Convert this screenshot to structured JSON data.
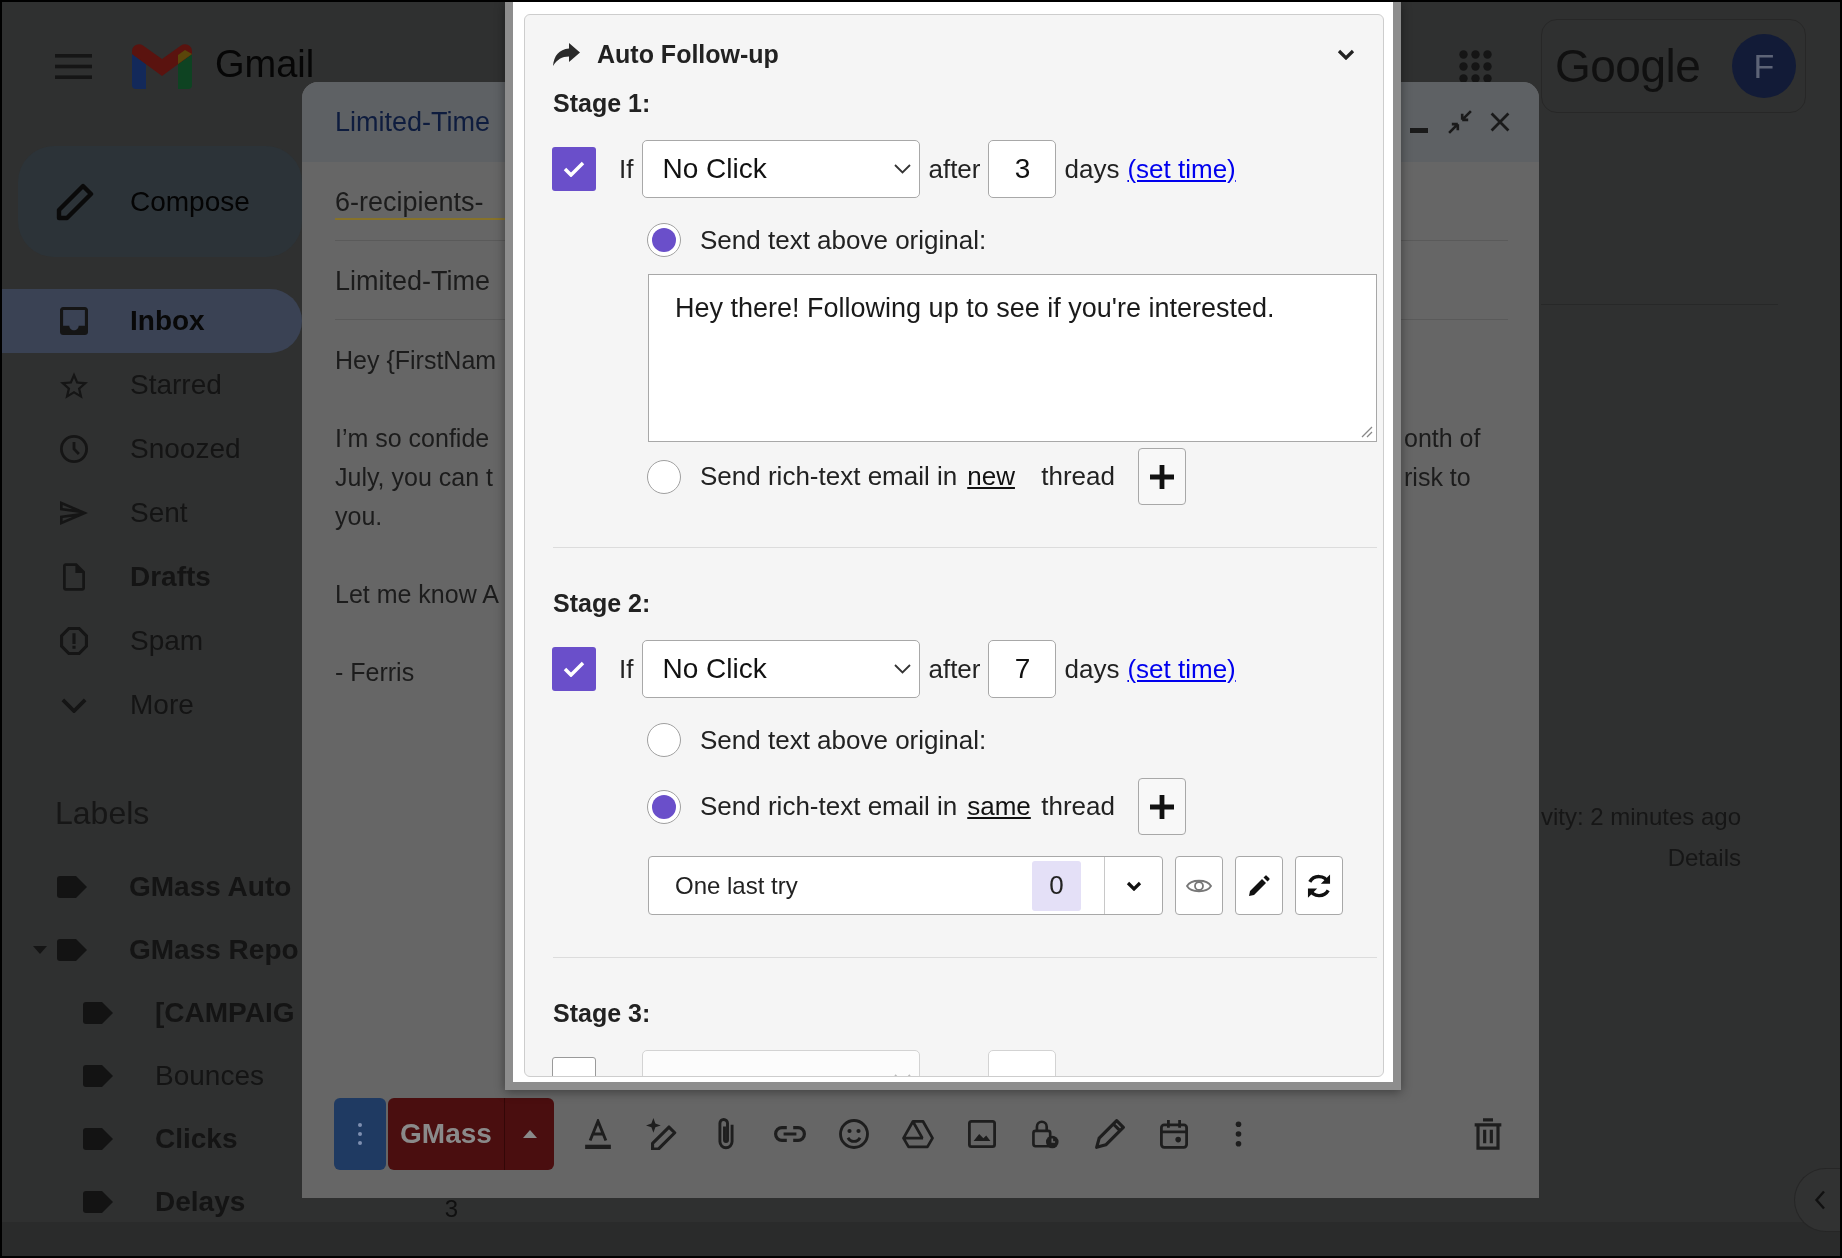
{
  "topbar": {
    "app_name": "Gmail",
    "brand": "Google",
    "account_initial": "F"
  },
  "sidebar": {
    "compose_label": "Compose",
    "nav_items": [
      {
        "kind": "inbox",
        "label": "Inbox",
        "selected": true,
        "unread": true
      },
      {
        "kind": "starred",
        "label": "Starred",
        "selected": false,
        "unread": false
      },
      {
        "kind": "snoozed",
        "label": "Snoozed",
        "selected": false,
        "unread": false
      },
      {
        "kind": "sent",
        "label": "Sent",
        "selected": false,
        "unread": false
      },
      {
        "kind": "drafts",
        "label": "Drafts",
        "selected": false,
        "unread": true
      },
      {
        "kind": "spam",
        "label": "Spam",
        "selected": false,
        "unread": false
      },
      {
        "kind": "more",
        "label": "More",
        "selected": false,
        "unread": false
      }
    ],
    "labels_heading": "Labels",
    "labels": [
      {
        "label": "GMass Auto",
        "unread": true,
        "expanded": false
      },
      {
        "label": "GMass Repo",
        "unread": true,
        "expanded": true,
        "children": [
          {
            "label": "[CAMPAIG",
            "unread": true
          },
          {
            "label": "Bounces",
            "unread": false
          },
          {
            "label": "Clicks",
            "unread": true
          },
          {
            "label": "Delays",
            "unread": true,
            "count": "3"
          }
        ]
      }
    ]
  },
  "compose": {
    "title": "Limited-Time",
    "recipients": {
      "value": "6-recipients-",
      "focused": true
    },
    "subject": {
      "value": "Limited-Time",
      "focused": false
    },
    "body": [
      {
        "lines": [
          {
            "left": "Hey {FirstNam"
          }
        ]
      },
      {
        "lines": [
          {
            "left": "I’m so confide",
            "right": "onth of"
          },
          {
            "left": "July, you can t",
            "right": "risk to"
          },
          {
            "left": "you."
          }
        ]
      },
      {
        "lines": [
          {
            "left": "Let me know A"
          }
        ]
      },
      {
        "lines": [
          {
            "left": "- Ferris"
          }
        ]
      }
    ],
    "send_label": "GMass"
  },
  "followup": {
    "title": "Auto Follow-up",
    "stages": [
      {
        "heading": "Stage 1:",
        "checked": true,
        "if_label": "If",
        "condition": "No Click",
        "after_label": "after",
        "days": "3",
        "days_label": "days",
        "set_time": "(set time)",
        "options": [
          {
            "kind": "text",
            "label": "Send text above original:",
            "selected": true,
            "message": "Hey there! Following up to see if you're interested."
          },
          {
            "kind": "email",
            "label": "Send rich-text email in",
            "thread_mode": "new",
            "thread_label": "thread",
            "selected": false
          }
        ]
      },
      {
        "heading": "Stage 2:",
        "checked": true,
        "if_label": "If",
        "condition": "No Click",
        "after_label": "after",
        "days": "7",
        "days_label": "days",
        "set_time": "(set time)",
        "options": [
          {
            "kind": "text",
            "label": "Send text above original:",
            "selected": false
          },
          {
            "kind": "email",
            "label": "Send rich-text email in",
            "thread_mode": "same",
            "thread_label": "thread",
            "selected": true,
            "template": {
              "name": "One last try",
              "count": "0"
            }
          }
        ]
      },
      {
        "heading": "Stage 3:",
        "checked": false
      }
    ]
  },
  "main": {
    "activity": "vity: 2 minutes ago",
    "details": "Details"
  }
}
